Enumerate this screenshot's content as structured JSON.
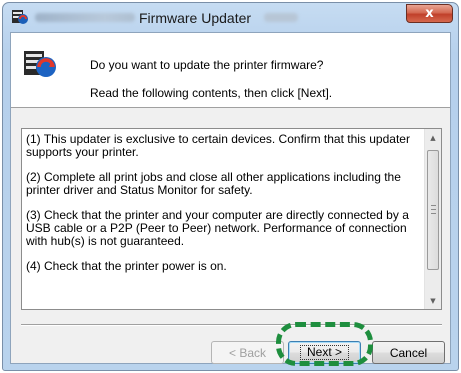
{
  "window": {
    "title": "Firmware Updater",
    "close_label": "x"
  },
  "header": {
    "prompt": "Do you want to update the printer firmware?",
    "instruction": "Read the following contents, then click [Next]."
  },
  "info": {
    "items": [
      "(1) This updater is exclusive to certain devices. Confirm that this updater supports your printer.",
      "(2) Complete all print jobs and close all other applications including the printer driver and Status Monitor for safety.",
      "(3) Check that the printer and your computer are directly connected by a USB cable or a P2P (Peer to Peer) network. Performance of connection with hub(s) is not guaranteed.",
      "(4) Check that the printer power is on."
    ]
  },
  "buttons": {
    "back": "< Back",
    "next": "Next >",
    "cancel": "Cancel"
  },
  "icons": {
    "title": "printer-update-icon",
    "header": "printer-update-icon",
    "close": "close-icon",
    "scroll_up": "chevron-up-icon",
    "scroll_down": "chevron-down-icon"
  },
  "colors": {
    "highlight": "#1e8e3e",
    "close_button": "#c0402a"
  }
}
